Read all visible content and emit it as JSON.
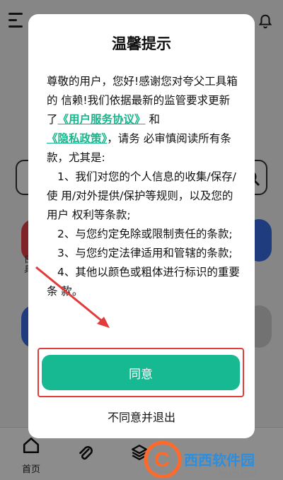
{
  "app": {
    "category_text": "日\n具",
    "bottom_nav": {
      "home_label": "首页"
    }
  },
  "dialog": {
    "title": "温馨提示",
    "intro_part1": "尊敬的用户，您好!感谢您对夸父工具箱的 信赖!我们依据最新的监管要求更新了",
    "user_agreement_link": "《用户服务协议》",
    "and": "和",
    "privacy_link": "《隐私政策》",
    "intro_part2": "，请务 必审慎阅读所有条款，尤其是:",
    "items": [
      "1、我们对您的个人信息的收集/保存/使 用/对外提供/保护等规则，以及您的用户 权利等条款;",
      "2、与您约定免除或限制责任的条款;",
      "3、与您约定法律适用和管辖的条款;",
      "4、其他以颜色或粗体进行标识的重要条 款。"
    ],
    "agree_label": "同意",
    "decline_label": "不同意并退出"
  },
  "watermark": {
    "brand": "西西软件园",
    "url": "CR173.COM"
  },
  "colors": {
    "accent": "#17b993",
    "link": "#19b58c",
    "highlight_box": "#e13b3b"
  }
}
